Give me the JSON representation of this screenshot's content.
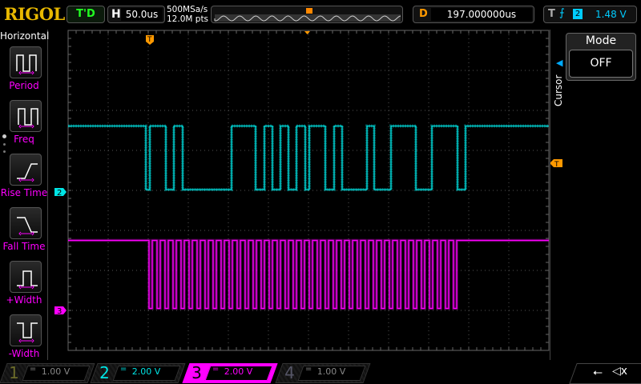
{
  "header": {
    "brand": "RIGOL",
    "run_status": "T'D",
    "timebase": {
      "label": "H",
      "value": "50.0us"
    },
    "sample_rate": "500MSa/s",
    "memory_depth": "12.0M pts",
    "delay": {
      "label": "D",
      "value": "197.000000us"
    },
    "trigger": {
      "label": "T",
      "edge": "rising",
      "source": "2",
      "level": "1.48 V"
    }
  },
  "left_menu": {
    "title": "Horizontal",
    "items": [
      {
        "label": "Period",
        "icon": "period-icon"
      },
      {
        "label": "Freq",
        "icon": "frequency-icon"
      },
      {
        "label": "Rise Time",
        "icon": "rise-time-icon"
      },
      {
        "label": "Fall Time",
        "icon": "fall-time-icon"
      },
      {
        "label": "+Width",
        "icon": "positive-width-icon"
      },
      {
        "label": "-Width",
        "icon": "negative-width-icon"
      }
    ]
  },
  "right_menu": {
    "section": "Cursor",
    "mode_label": "Mode",
    "mode_value": "OFF"
  },
  "channels": [
    {
      "num": "1",
      "coupling": "=",
      "scale": "1.00 V",
      "active": false,
      "color": "#6b6b2a"
    },
    {
      "num": "2",
      "coupling": "=",
      "scale": "2.00 V",
      "active": true,
      "color": "#00e5e5"
    },
    {
      "num": "3",
      "coupling": "=",
      "scale": "2.00 V",
      "active": true,
      "selected": true,
      "color": "#ff00ff"
    },
    {
      "num": "4",
      "coupling": "=",
      "scale": "1.00 V",
      "active": false,
      "color": "#555566"
    }
  ],
  "markers": {
    "ch2": "2",
    "ch3": "3",
    "trigger": "T"
  },
  "colors": {
    "ch2": "#00e5e5",
    "ch3": "#ff00ff",
    "trigger": "#ff9900",
    "grid": "#555555"
  },
  "chart_data": {
    "type": "line",
    "x_unit": "us",
    "xlim": [
      -103,
      497
    ],
    "x_per_div": 50,
    "grid": true,
    "series": [
      {
        "channel": "2",
        "kind": "digital",
        "volts_per_div": 2,
        "high_v": 3.3,
        "low_v": 0,
        "initial": "high",
        "transitions_us": [
          -6,
          -1,
          19,
          29,
          40,
          101,
          131,
          142,
          152,
          162,
          172,
          182,
          193,
          198,
          218,
          229,
          239,
          270,
          279,
          300,
          331,
          351,
          383,
          393
        ]
      },
      {
        "channel": "3",
        "kind": "clock",
        "volts_per_div": 2,
        "high_v": 3.5,
        "low_v": 0.1,
        "initial": "high",
        "clock_start_us": -2,
        "period_us": 10,
        "low_us": 4,
        "cycles": 39
      }
    ]
  },
  "status_icons": [
    "usb-icon",
    "mute-icon"
  ]
}
